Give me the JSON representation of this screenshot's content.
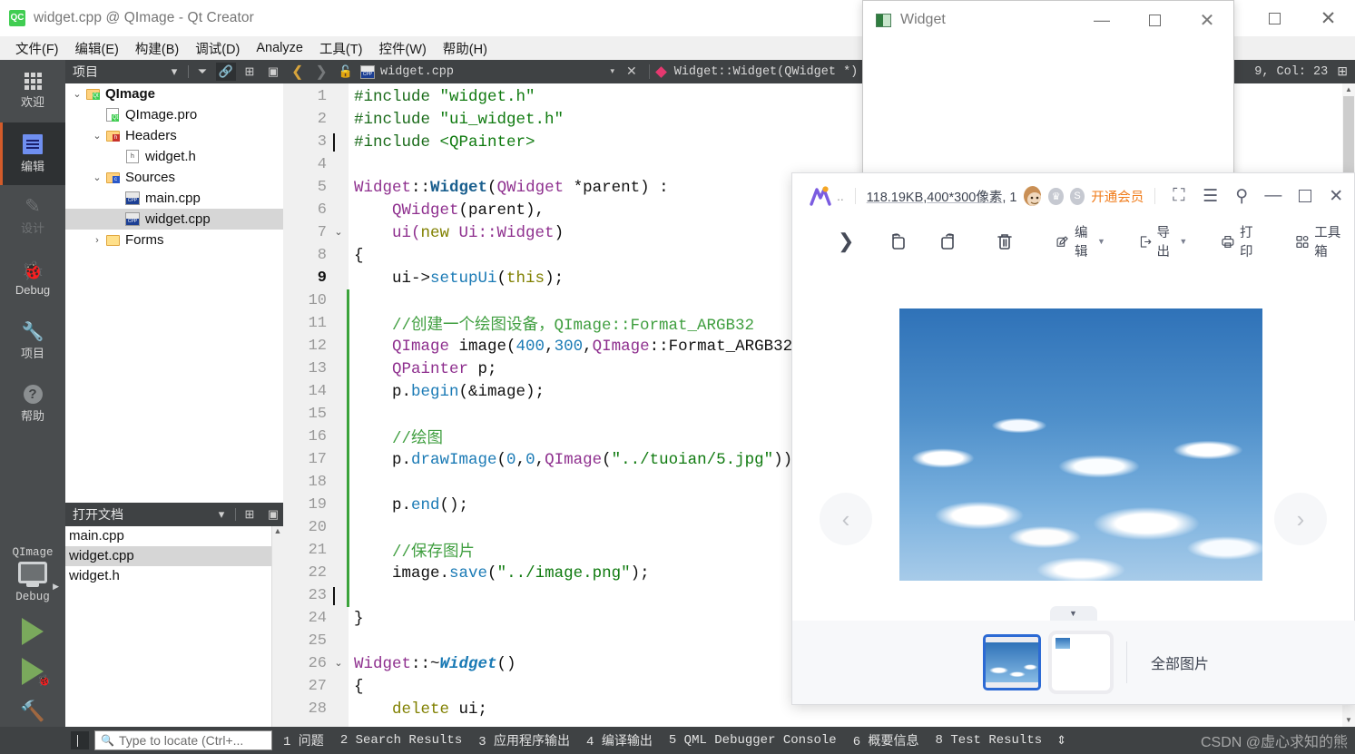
{
  "qtcreator": {
    "title": "widget.cpp @ QImage - Qt Creator",
    "logo_text": "QC",
    "menu": [
      {
        "label": "文件(F)",
        "name": "menu-file"
      },
      {
        "label": "编辑(E)",
        "name": "menu-edit"
      },
      {
        "label": "构建(B)",
        "name": "menu-build"
      },
      {
        "label": "调试(D)",
        "name": "menu-debug"
      },
      {
        "label": "Analyze",
        "name": "menu-analyze"
      },
      {
        "label": "工具(T)",
        "name": "menu-tools"
      },
      {
        "label": "控件(W)",
        "name": "menu-window"
      },
      {
        "label": "帮助(H)",
        "name": "menu-help"
      }
    ],
    "window_controls": {
      "minimize": "—",
      "maximize": "□",
      "close": "✕"
    },
    "modes": [
      {
        "label": "欢迎",
        "icon": "grid-icon",
        "state": "normal"
      },
      {
        "label": "编辑",
        "icon": "document-icon",
        "state": "active"
      },
      {
        "label": "设计",
        "icon": "pencil-icon",
        "state": "disabled"
      },
      {
        "label": "Debug",
        "icon": "bug-icon",
        "state": "normal"
      },
      {
        "label": "项目",
        "icon": "wrench-icon",
        "state": "normal"
      },
      {
        "label": "帮助",
        "icon": "question-circle-icon",
        "state": "normal"
      }
    ],
    "run_panel": {
      "kit_name": "QImage",
      "build_config": "Debug",
      "run_label": "run-button",
      "debug_label": "debug-button",
      "build_label": "build-button"
    },
    "project_panel": {
      "title": "项目",
      "tree": [
        {
          "label": "QImage",
          "indent": 0,
          "twist": "v",
          "icon": "folder-qt-icon",
          "bold": true,
          "selected": false
        },
        {
          "label": "QImage.pro",
          "indent": 1,
          "twist": "",
          "icon": "file-pro-icon",
          "bold": false,
          "selected": false
        },
        {
          "label": "Headers",
          "indent": 1,
          "twist": "v",
          "icon": "folder-h-icon",
          "bold": false,
          "selected": false
        },
        {
          "label": "widget.h",
          "indent": 2,
          "twist": "",
          "icon": "file-h-icon",
          "bold": false,
          "selected": false
        },
        {
          "label": "Sources",
          "indent": 1,
          "twist": "v",
          "icon": "folder-cpp-icon",
          "bold": false,
          "selected": false
        },
        {
          "label": "main.cpp",
          "indent": 2,
          "twist": "",
          "icon": "file-cpp-icon",
          "bold": false,
          "selected": false
        },
        {
          "label": "widget.cpp",
          "indent": 2,
          "twist": "",
          "icon": "file-cpp-icon",
          "bold": false,
          "selected": true
        },
        {
          "label": "Forms",
          "indent": 1,
          "twist": ">",
          "icon": "folder-form-icon",
          "bold": false,
          "selected": false
        }
      ]
    },
    "opendocs_panel": {
      "title": "打开文档",
      "items": [
        {
          "label": "main.cpp",
          "selected": false
        },
        {
          "label": "widget.cpp",
          "selected": true
        },
        {
          "label": "widget.h",
          "selected": false
        }
      ]
    },
    "editor_toolbar": {
      "filename": "widget.cpp",
      "symbol": "Widget::Widget(QWidget *) -> void",
      "cursor_position": "9, Col: 23"
    },
    "code_lines": [
      {
        "n": "1",
        "fold": "",
        "changed": false,
        "cur": false,
        "caret": false,
        "tokens": [
          {
            "t": "#include ",
            "c": "pp"
          },
          {
            "t": "\"widget.h\"",
            "c": "str"
          }
        ]
      },
      {
        "n": "2",
        "fold": "",
        "changed": false,
        "cur": false,
        "caret": false,
        "tokens": [
          {
            "t": "#include ",
            "c": "pp"
          },
          {
            "t": "\"ui_widget.h\"",
            "c": "str"
          }
        ]
      },
      {
        "n": "3",
        "fold": "",
        "changed": false,
        "cur": false,
        "caret": true,
        "tokens": [
          {
            "t": "#include ",
            "c": "pp"
          },
          {
            "t": "<QPainter>",
            "c": "str"
          }
        ]
      },
      {
        "n": "4",
        "fold": "",
        "changed": false,
        "cur": false,
        "caret": false,
        "tokens": []
      },
      {
        "n": "5",
        "fold": "",
        "changed": false,
        "cur": false,
        "caret": false,
        "tokens": [
          {
            "t": "Widget",
            "c": "type"
          },
          {
            "t": "::",
            "c": "plain"
          },
          {
            "t": "Widget",
            "c": "bld"
          },
          {
            "t": "(",
            "c": "plain"
          },
          {
            "t": "QWidget",
            "c": "type"
          },
          {
            "t": " *parent) :",
            "c": "plain"
          }
        ]
      },
      {
        "n": "6",
        "fold": "",
        "changed": false,
        "cur": false,
        "caret": false,
        "tokens": [
          {
            "t": "    ",
            "c": "plain"
          },
          {
            "t": "QWidget",
            "c": "type"
          },
          {
            "t": "(parent),",
            "c": "plain"
          }
        ]
      },
      {
        "n": "7",
        "fold": "v",
        "changed": false,
        "cur": false,
        "caret": false,
        "tokens": [
          {
            "t": "    ui(",
            "c": "type"
          },
          {
            "t": "new",
            "c": "kw"
          },
          {
            "t": " Ui::",
            "c": "type"
          },
          {
            "t": "Widget",
            "c": "type"
          },
          {
            "t": ")",
            "c": "plain"
          }
        ]
      },
      {
        "n": "8",
        "fold": "",
        "changed": false,
        "cur": false,
        "caret": false,
        "tokens": [
          {
            "t": "{",
            "c": "plain"
          }
        ]
      },
      {
        "n": "9",
        "fold": "",
        "changed": false,
        "cur": true,
        "caret": false,
        "tokens": [
          {
            "t": "    ui->",
            "c": "plain"
          },
          {
            "t": "setupUi",
            "c": "fn"
          },
          {
            "t": "(",
            "c": "plain"
          },
          {
            "t": "this",
            "c": "kw"
          },
          {
            "t": ");",
            "c": "plain"
          }
        ]
      },
      {
        "n": "10",
        "fold": "",
        "changed": true,
        "cur": false,
        "caret": false,
        "tokens": []
      },
      {
        "n": "11",
        "fold": "",
        "changed": true,
        "cur": false,
        "caret": false,
        "tokens": [
          {
            "t": "    //创建一个绘图设备，QImage::Format_ARGB32",
            "c": "cmt"
          }
        ]
      },
      {
        "n": "12",
        "fold": "",
        "changed": true,
        "cur": false,
        "caret": false,
        "tokens": [
          {
            "t": "    ",
            "c": "plain"
          },
          {
            "t": "QImage",
            "c": "type"
          },
          {
            "t": " image(",
            "c": "plain"
          },
          {
            "t": "400",
            "c": "num"
          },
          {
            "t": ",",
            "c": "plain"
          },
          {
            "t": "300",
            "c": "num"
          },
          {
            "t": ",",
            "c": "plain"
          },
          {
            "t": "QImage",
            "c": "type"
          },
          {
            "t": "::Format_ARGB32);",
            "c": "plain"
          }
        ]
      },
      {
        "n": "13",
        "fold": "",
        "changed": true,
        "cur": false,
        "caret": false,
        "tokens": [
          {
            "t": "    ",
            "c": "plain"
          },
          {
            "t": "QPainter",
            "c": "type"
          },
          {
            "t": " p;",
            "c": "plain"
          }
        ]
      },
      {
        "n": "14",
        "fold": "",
        "changed": true,
        "cur": false,
        "caret": false,
        "tokens": [
          {
            "t": "    p.",
            "c": "plain"
          },
          {
            "t": "begin",
            "c": "fn"
          },
          {
            "t": "(&image);",
            "c": "plain"
          }
        ]
      },
      {
        "n": "15",
        "fold": "",
        "changed": true,
        "cur": false,
        "caret": false,
        "tokens": []
      },
      {
        "n": "16",
        "fold": "",
        "changed": true,
        "cur": false,
        "caret": false,
        "tokens": [
          {
            "t": "    //绘图",
            "c": "cmt"
          }
        ]
      },
      {
        "n": "17",
        "fold": "",
        "changed": true,
        "cur": false,
        "caret": false,
        "tokens": [
          {
            "t": "    p.",
            "c": "plain"
          },
          {
            "t": "drawImage",
            "c": "fn"
          },
          {
            "t": "(",
            "c": "plain"
          },
          {
            "t": "0",
            "c": "num"
          },
          {
            "t": ",",
            "c": "plain"
          },
          {
            "t": "0",
            "c": "num"
          },
          {
            "t": ",",
            "c": "plain"
          },
          {
            "t": "QImage",
            "c": "type"
          },
          {
            "t": "(",
            "c": "plain"
          },
          {
            "t": "\"../tuoian/5.jpg\"",
            "c": "str"
          },
          {
            "t": "));",
            "c": "plain"
          }
        ]
      },
      {
        "n": "18",
        "fold": "",
        "changed": true,
        "cur": false,
        "caret": false,
        "tokens": []
      },
      {
        "n": "19",
        "fold": "",
        "changed": true,
        "cur": false,
        "caret": false,
        "tokens": [
          {
            "t": "    p.",
            "c": "plain"
          },
          {
            "t": "end",
            "c": "fn"
          },
          {
            "t": "();",
            "c": "plain"
          }
        ]
      },
      {
        "n": "20",
        "fold": "",
        "changed": true,
        "cur": false,
        "caret": false,
        "tokens": []
      },
      {
        "n": "21",
        "fold": "",
        "changed": true,
        "cur": false,
        "caret": false,
        "tokens": [
          {
            "t": "    //保存图片",
            "c": "cmt"
          }
        ]
      },
      {
        "n": "22",
        "fold": "",
        "changed": true,
        "cur": false,
        "caret": false,
        "tokens": [
          {
            "t": "    image.",
            "c": "plain"
          },
          {
            "t": "save",
            "c": "fn"
          },
          {
            "t": "(",
            "c": "plain"
          },
          {
            "t": "\"../image.png\"",
            "c": "str"
          },
          {
            "t": ");",
            "c": "plain"
          }
        ]
      },
      {
        "n": "23",
        "fold": "",
        "changed": true,
        "cur": false,
        "caret": true,
        "tokens": []
      },
      {
        "n": "24",
        "fold": "",
        "changed": false,
        "cur": false,
        "caret": false,
        "tokens": [
          {
            "t": "}",
            "c": "plain"
          }
        ]
      },
      {
        "n": "25",
        "fold": "",
        "changed": false,
        "cur": false,
        "caret": false,
        "tokens": []
      },
      {
        "n": "26",
        "fold": "v",
        "changed": false,
        "cur": false,
        "caret": false,
        "tokens": [
          {
            "t": "Widget",
            "c": "type"
          },
          {
            "t": "::~",
            "c": "plain"
          },
          {
            "t": "Widget",
            "c": "itl"
          },
          {
            "t": "()",
            "c": "plain"
          }
        ]
      },
      {
        "n": "27",
        "fold": "",
        "changed": false,
        "cur": false,
        "caret": false,
        "tokens": [
          {
            "t": "{",
            "c": "plain"
          }
        ]
      },
      {
        "n": "28",
        "fold": "",
        "changed": false,
        "cur": false,
        "caret": false,
        "tokens": [
          {
            "t": "    ",
            "c": "plain"
          },
          {
            "t": "delete",
            "c": "kw"
          },
          {
            "t": " ui;",
            "c": "plain"
          }
        ]
      }
    ],
    "statusbar": {
      "locator_placeholder": "Type to locate (Ctrl+...",
      "panes": [
        "1 问题",
        "2 Search Results",
        "3 应用程序输出",
        "4 编译输出",
        "5 QML Debugger Console",
        "6 概要信息",
        "8 Test Results"
      ],
      "watermark": "CSDN @虚心求知的熊"
    }
  },
  "widget_window": {
    "title": "Widget",
    "minimize": "—",
    "maximize": "□",
    "close": "✕"
  },
  "image_viewer": {
    "app_dots": "..",
    "file_size": "118.19KB",
    "dimensions": "400*300像素",
    "extra": ", 1",
    "vip_label": "开通会员",
    "window_buttons": {
      "fullscreen": "fullscreen-icon",
      "menu": "menu-icon",
      "pin": "pin-icon",
      "minimize": "—",
      "maximize": "□",
      "close": "✕"
    },
    "toolbar": [
      {
        "label": "",
        "name": "next-arrow-button",
        "icon": "chevron-right-icon"
      },
      {
        "label": "",
        "name": "rotate-left-button",
        "icon": "rotate-left-icon"
      },
      {
        "label": "",
        "name": "rotate-right-button",
        "icon": "rotate-right-icon"
      },
      {
        "label": "",
        "name": "delete-button",
        "icon": "trash-icon"
      },
      {
        "label": "编辑",
        "name": "edit-button",
        "icon": "edit-icon",
        "caret": true
      },
      {
        "label": "导出",
        "name": "export-button",
        "icon": "export-icon",
        "caret": true
      },
      {
        "label": "打印",
        "name": "print-button",
        "icon": "printer-icon"
      },
      {
        "label": "工具箱",
        "name": "toolbox-button",
        "icon": "toolbox-icon"
      }
    ],
    "nav_prev": "‹",
    "nav_next": "›",
    "strip_all_label": "全部图片"
  }
}
